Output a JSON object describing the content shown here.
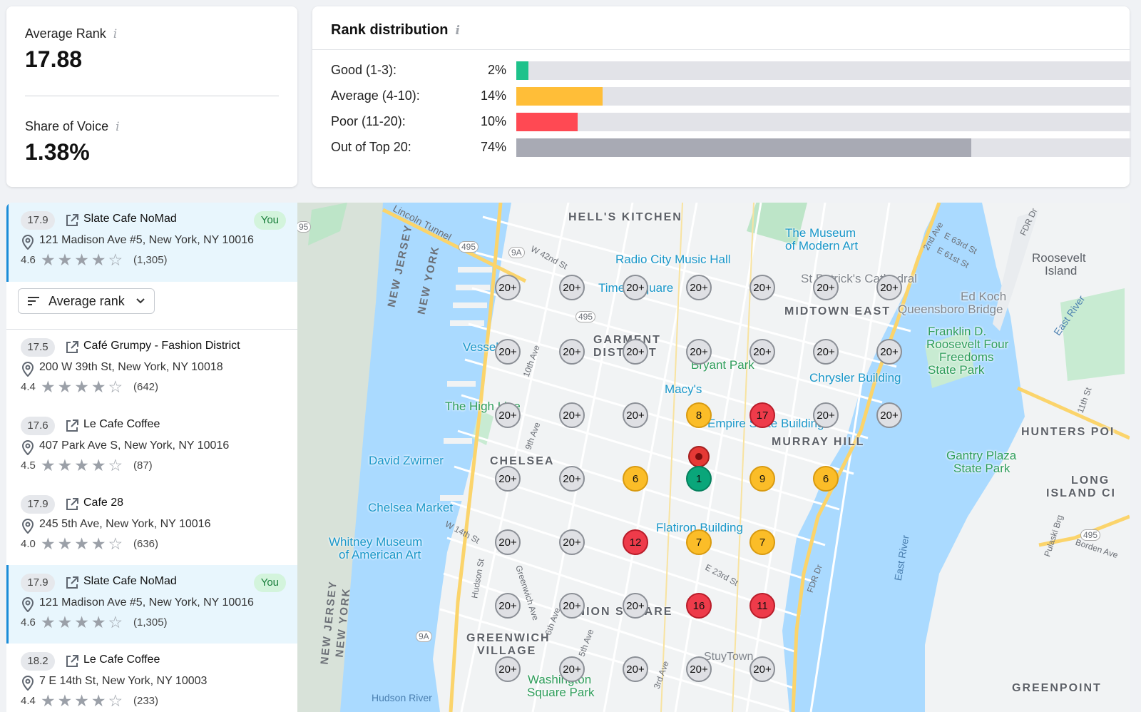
{
  "metrics": {
    "average_rank_label": "Average Rank",
    "average_rank_value": "17.88",
    "share_of_voice_label": "Share of Voice",
    "share_of_voice_value": "1.38%",
    "info_glyph": "i"
  },
  "rank_distribution": {
    "title": "Rank distribution",
    "rows": [
      {
        "label": "Good (1-3):",
        "percent": "2%",
        "value": 0.02,
        "color": "#1ec28b"
      },
      {
        "label": "Average (4-10):",
        "percent": "14%",
        "value": 0.14,
        "color": "#ffbe38"
      },
      {
        "label": "Poor (11-20):",
        "percent": "10%",
        "value": 0.1,
        "color": "#ff4953"
      },
      {
        "label": "Out of Top 20:",
        "percent": "74%",
        "value": 0.74,
        "color": "#a8aab4"
      }
    ]
  },
  "sort": {
    "label": "Average rank"
  },
  "businesses": [
    {
      "rank": "17.9",
      "name": "Slate Cafe NoMad",
      "address": "121 Madison Ave #5, New York, NY 10016",
      "rating": "4.6",
      "stars": "★★★★☆",
      "reviews": "(1,305)",
      "you": true,
      "badge": "You"
    },
    {
      "rank": "17.5",
      "name": "Café Grumpy - Fashion District",
      "address": "200 W 39th St, New York, NY 10018",
      "rating": "4.4",
      "stars": "★★★★☆",
      "reviews": "(642)",
      "you": false
    },
    {
      "rank": "17.6",
      "name": "Le Cafe Coffee",
      "address": "407 Park Ave S, New York, NY 10016",
      "rating": "4.5",
      "stars": "★★★★☆",
      "reviews": "(87)",
      "you": false
    },
    {
      "rank": "17.9",
      "name": "Cafe 28",
      "address": "245 5th Ave, New York, NY 10016",
      "rating": "4.0",
      "stars": "★★★★☆",
      "reviews": "(636)",
      "you": false
    },
    {
      "rank": "17.9",
      "name": "Slate Cafe NoMad",
      "address": "121 Madison Ave #5, New York, NY 10016",
      "rating": "4.6",
      "stars": "★★★★☆",
      "reviews": "(1,305)",
      "you": true,
      "badge": "You"
    },
    {
      "rank": "18.2",
      "name": "Le Cafe Coffee",
      "address": "7 E 14th St, New York, NY 10003",
      "rating": "4.4",
      "stars": "★★★★☆",
      "reviews": "(233)",
      "you": false
    }
  ],
  "map": {
    "grid_ranks": [
      [
        "20+",
        "20+",
        "20+",
        "20+",
        "20+",
        "20+",
        "20+"
      ],
      [
        "20+",
        "20+",
        "20+",
        "20+",
        "20+",
        "20+",
        "20+"
      ],
      [
        "20+",
        "20+",
        "20+",
        "8",
        "17",
        "20+",
        "20+"
      ],
      [
        "20+",
        "20+",
        "6",
        "1",
        "9",
        "6",
        ""
      ],
      [
        "20+",
        "20+",
        "12",
        "7",
        "7",
        "",
        ""
      ],
      [
        "20+",
        "20+",
        "20+",
        "16",
        "11",
        "",
        ""
      ],
      [
        "20+",
        "20+",
        "20+",
        "20+",
        "20+",
        "",
        ""
      ]
    ],
    "labels": {
      "hells_kitchen": "HELL'S KITCHEN",
      "midtown_east": "MIDTOWN EAST",
      "murray_hill": "MURRAY HILL",
      "chelsea": "CHELSEA",
      "garment_1": "GARMENT",
      "garment_2": "DISTRICT",
      "greenwich_1": "GREENWICH",
      "greenwich_2": "VILLAGE",
      "hunters_point": "HUNTERS POI",
      "lic_1": "LONG",
      "lic_2": "ISLAND CI",
      "greenpoint": "GREENPOINT",
      "union_square": "UNION SQUARE",
      "moma_1": "The Museum",
      "moma_2": "of Modern Art",
      "radio_city": "Radio City Music Hall",
      "times_square": "Times Square",
      "st_patricks": "St Patrick's Cathedral",
      "ed_koch": "Ed Koch",
      "queensboro": "Queensboro Bridge",
      "roosevelt_1": "Roosevelt",
      "roosevelt_2": "Island",
      "fdr_1": "Franklin D.",
      "fdr_2": "Roosevelt Four",
      "fdr_3": "Freedoms",
      "fdr_4": "State Park",
      "vessel": "Vessel",
      "bryant_park": "Bryant Park",
      "chrysler": "Chrysler Building",
      "macys": "Macy's",
      "high_line": "The High Line",
      "empire_state": "Empire State Building",
      "david_zwirner": "David Zwirner",
      "chelsea_market": "Chelsea Market",
      "whitney_1": "Whitney Museum",
      "whitney_2": "of American Art",
      "flatiron": "Flatiron Building",
      "gantry_1": "Gantry Plaza",
      "gantry_2": "State Park",
      "washington_1": "Washington",
      "washington_2": "Square Park",
      "stuytown": "StuyTown",
      "hudson_river": "Hudson River",
      "east_river_1": "East River",
      "east_river_2": "East River",
      "nj_1": "NEW JERSEY",
      "ny_1": "NEW YORK",
      "nj_2": "NEW JERSEY",
      "ny_2": "NEW YORK",
      "lincoln_tunnel": "Lincoln Tunnel",
      "fdr_dr_1": "FDR Dr",
      "fdr_dr_2": "FDR Dr",
      "w42": "W 42nd St",
      "e63": "E 63rd St",
      "e61": "E 61st St",
      "ave2": "2nd Ave",
      "ave10": "10th Ave",
      "ave9": "9th Ave",
      "w14": "W 14th St",
      "e23": "E 23rd St",
      "hudson_st": "Hudson St",
      "greenwich_ave": "Greenwich Ave",
      "ave6": "6th Ave",
      "ave5": "5th Ave",
      "ave3": "3rd Ave",
      "borden": "Borden Ave",
      "pulaski": "Pulaski Brg",
      "st11": "11th St",
      "r495a": "495",
      "r495b": "495",
      "r495c": "495",
      "r9a_a": "9A",
      "r9a_b": "9A",
      "r95": "95"
    }
  }
}
